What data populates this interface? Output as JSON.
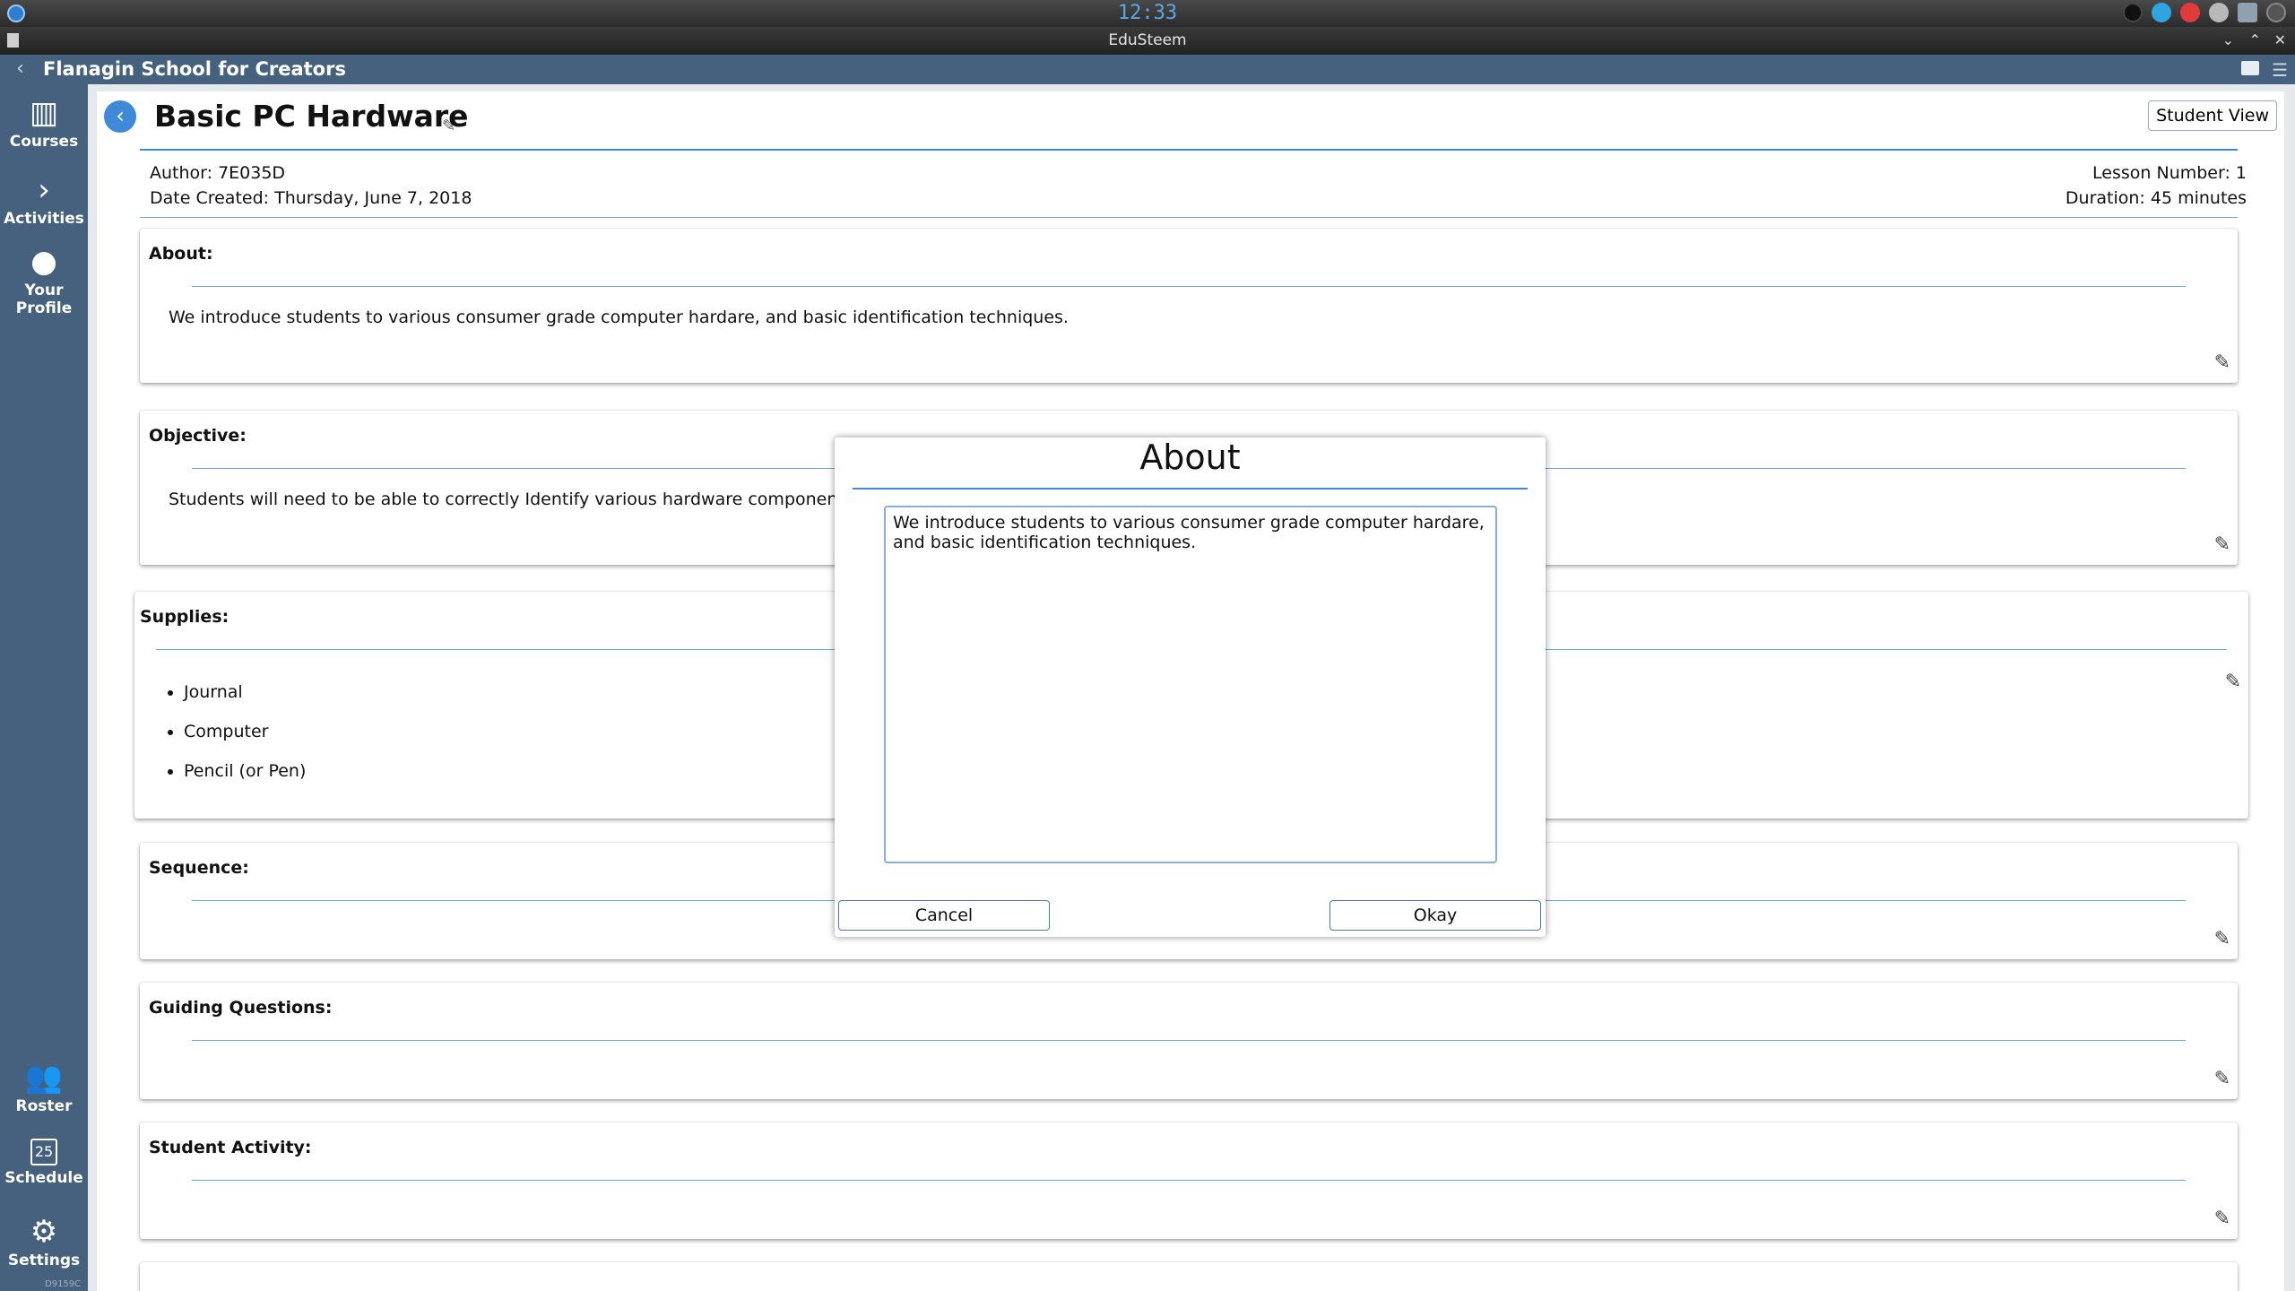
{
  "system": {
    "clock": "12:33"
  },
  "window": {
    "title": "EduSteem"
  },
  "header": {
    "school": "Flanagin School for Creators"
  },
  "sidebar": {
    "top": [
      {
        "id": "courses",
        "label": "Courses",
        "icon": "book-icon"
      },
      {
        "id": "activities",
        "label": "Activities",
        "icon": "chevron-right-icon"
      },
      {
        "id": "profile",
        "label": "Your Profile",
        "icon": "person-icon"
      }
    ],
    "bottom": [
      {
        "id": "roster",
        "label": "Roster",
        "icon": "people-icon"
      },
      {
        "id": "schedule",
        "label": "Schedule",
        "icon": "calendar-icon",
        "date": "25"
      },
      {
        "id": "settings",
        "label": "Settings",
        "icon": "gear-icon"
      }
    ],
    "version": "D9159C"
  },
  "lesson": {
    "title": "Basic PC Hardware",
    "student_view": "Student View",
    "author": "Author: 7E035D",
    "date_created": "Date Created: Thursday, June 7, 2018",
    "lesson_number": "Lesson Number: 1",
    "duration": "Duration: 45 minutes"
  },
  "sections": {
    "about": {
      "label": "About:",
      "text": "We introduce students to various consumer grade computer hardare, and basic identification techniques."
    },
    "objective": {
      "label": "Objective:",
      "text": "Students will need to be able to correctly Identify various hardware components a"
    },
    "supplies": {
      "label": "Supplies:",
      "items": [
        "Journal",
        "Computer",
        "Pencil (or Pen)"
      ]
    },
    "sequence": {
      "label": "Sequence:"
    },
    "guiding": {
      "label": "Guiding Questions:"
    },
    "activity": {
      "label": "Student Activity:"
    }
  },
  "modal": {
    "title": "About",
    "text": "We introduce students to various consumer grade computer hardare, and basic identification techniques.",
    "cancel": "Cancel",
    "okay": "Okay"
  },
  "colors": {
    "accent": "#3e8ad8",
    "sidebar": "#45617d"
  }
}
